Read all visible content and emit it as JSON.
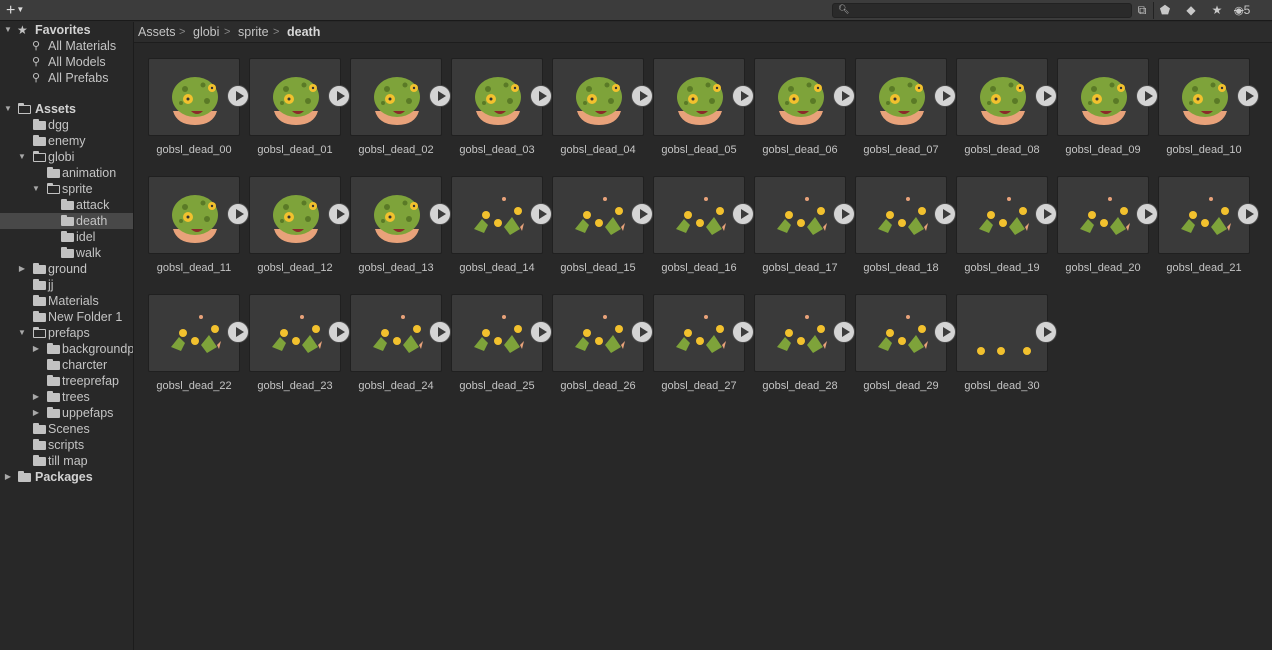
{
  "toolbar": {
    "add_icon": "plus-icon",
    "search_placeholder": "",
    "hidden_count": "5"
  },
  "sidebar": {
    "favorites": {
      "label": "Favorites",
      "items": [
        "All Materials",
        "All Models",
        "All Prefabs"
      ]
    },
    "assets": {
      "label": "Assets",
      "items": [
        {
          "label": "dgg"
        },
        {
          "label": "enemy"
        },
        {
          "label": "globi"
        },
        {
          "label": "animation"
        },
        {
          "label": "sprite"
        },
        {
          "label": "attack"
        },
        {
          "label": "death"
        },
        {
          "label": "idel"
        },
        {
          "label": "walk"
        },
        {
          "label": "ground"
        },
        {
          "label": "jj"
        },
        {
          "label": "Materials"
        },
        {
          "label": "New Folder 1"
        },
        {
          "label": "prefaps"
        },
        {
          "label": "backgroundp"
        },
        {
          "label": "charcter"
        },
        {
          "label": "treeprefap"
        },
        {
          "label": "trees"
        },
        {
          "label": "uppefaps"
        },
        {
          "label": "Scenes"
        },
        {
          "label": "scripts"
        },
        {
          "label": "till map"
        }
      ]
    },
    "packages": {
      "label": "Packages"
    }
  },
  "breadcrumb": [
    "Assets",
    "globi",
    "sprite",
    "death"
  ],
  "assets": [
    "gobsl_dead_00",
    "gobsl_dead_01",
    "gobsl_dead_02",
    "gobsl_dead_03",
    "gobsl_dead_04",
    "gobsl_dead_05",
    "gobsl_dead_06",
    "gobsl_dead_07",
    "gobsl_dead_08",
    "gobsl_dead_09",
    "gobsl_dead_10",
    "gobsl_dead_11",
    "gobsl_dead_12",
    "gobsl_dead_13",
    "gobsl_dead_14",
    "gobsl_dead_15",
    "gobsl_dead_16",
    "gobsl_dead_17",
    "gobsl_dead_18",
    "gobsl_dead_19",
    "gobsl_dead_20",
    "gobsl_dead_21",
    "gobsl_dead_22",
    "gobsl_dead_23",
    "gobsl_dead_24",
    "gobsl_dead_25",
    "gobsl_dead_26",
    "gobsl_dead_27",
    "gobsl_dead_28",
    "gobsl_dead_29",
    "gobsl_dead_30"
  ],
  "colors": {
    "background": "#282828",
    "selected_row": "#484848",
    "thumb_bg": "#3a3a3a",
    "sprite_green": "#7ea33a",
    "sprite_yellow": "#f2c12e",
    "sprite_orange": "#e8a27a"
  }
}
